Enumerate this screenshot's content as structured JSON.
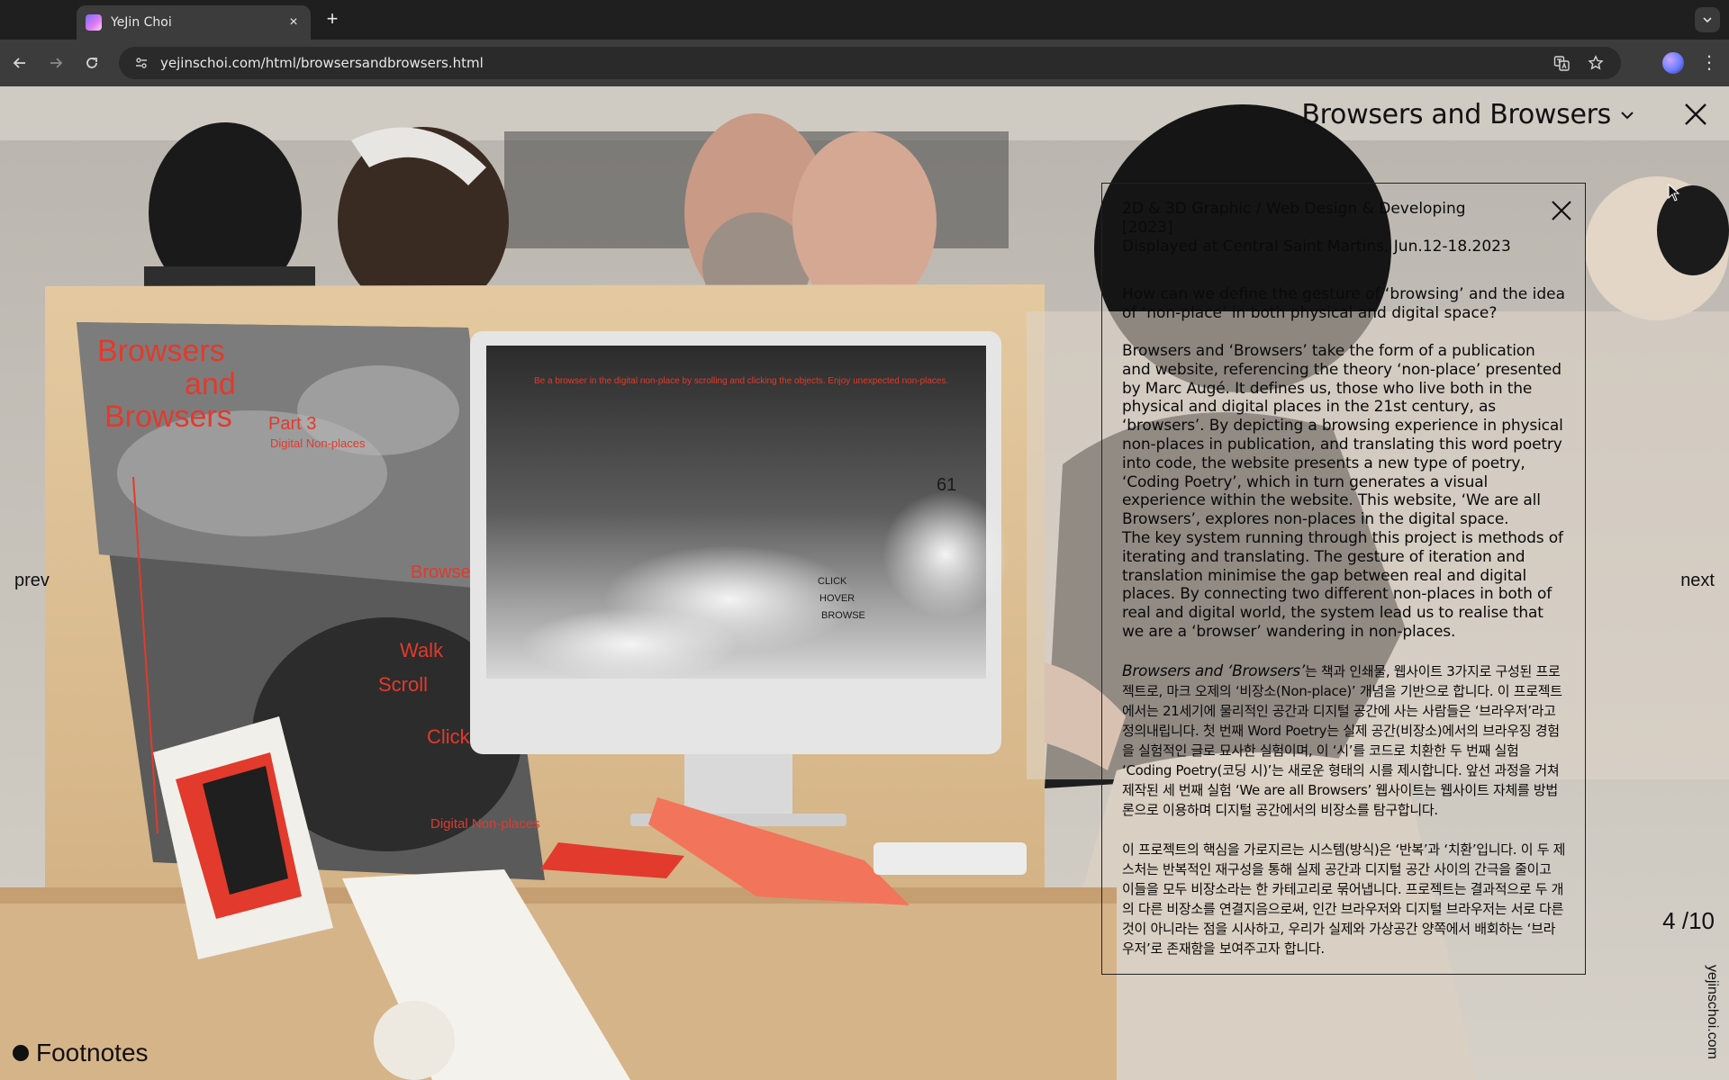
{
  "browser": {
    "tab_title": "YeJin Choi",
    "tab_close": "×",
    "new_tab": "+",
    "url": "yejinschoi.com/html/browsersandbrowsers.html"
  },
  "page": {
    "project_title": "Browsers and Browsers",
    "prev": "prev",
    "next": "next",
    "counter": "4 /10",
    "site_vertical": "yejinschoi.com",
    "footnotes": "Footnotes",
    "photo_text": {
      "poster_title_1": "Browsers",
      "poster_title_2": "and",
      "poster_title_3": "Browsers",
      "poster_part": "Part 3",
      "poster_subtitle": "Digital Non-places",
      "poster_browse": "Browse",
      "poster_walk": "Walk",
      "poster_scroll": "Scroll",
      "poster_click": "Click",
      "poster_footer": "Digital Non-places",
      "screen_text": "Be a browser in the digital non-place by scrolling and clicking the objects. Enjoy unexpected non-places.",
      "screen_number": "61",
      "screen_menu_1": "CLICK",
      "screen_menu_2": "HOVER",
      "screen_menu_3": "BROWSE"
    }
  },
  "info": {
    "meta_line_1": "2D & 3D Graphic / Web Design & Developing [2023]",
    "meta_line_2": "Displayed at Central Saint Martins, Jun.12-18.2023",
    "question": "How can we define the gesture of ‘browsing’ and the idea of ‘non-place’ in both physical and digital space?",
    "para_en": "Browsers and ‘Browsers’ take the form of a publication and website, referencing the theory ‘non-place’ presented by Marc Augé. It defines us, those who live both in the physical and digital places in the 21st century, as ‘browsers’. By depicting a browsing experience in physical non-places in publication, and translating this word poetry into code, the website presents a new type of poetry, ‘Coding Poetry’, which in turn generates a visual experience within the website. This website, ‘We are all Browsers’, explores non-places in the digital space.\nThe key system running through this project is methods of iterating and translating. The gesture of iteration and translation minimise the gap between real and digital places. By connecting two different non-places in both of real and digital world, the system lead us to realise that we are a ‘browser’ wandering in non-places.",
    "para_ko_italic": "Browsers and ‘Browsers’",
    "para_ko_rest": "는 책과 인쇄물, 웹사이트 3가지로 구성된 프로젝트로, 마크 오제의 ‘비장소(Non-place)’ 개념을 기반으로 합니다. 이 프로젝트에서는 21세기에 물리적인 공간과 디지털 공간에 사는 사람들은 ‘브라우저’라고 정의내립니다. 첫 번째 Word Poetry는 실제 공간(비장소)에서의 브라우징 경험을 실험적인 글로 묘사한 실험이며, 이 ‘시’를 코드로 치환한 두 번째 실험 ‘Coding Poetry(코딩 시)’는 새로운 형태의 시를 제시합니다. 앞선 과정을 거쳐 제작된 세 번째 실험 ‘We are all Browsers’ 웹사이트는 웹사이트 자체를 방법론으로 이용하며 디지털 공간에서의 비장소를 탐구합니다.",
    "para_ko2": "이 프로젝트의 핵심을 가로지르는 시스템(방식)은 ‘반복’과 ‘치환’입니다. 이 두 제스처는 반복적인 재구성을 통해 실제 공간과 디지털 공간 사이의 간극을 줄이고 이들을 모두 비장소라는 한 카테고리로 묶어냅니다. 프로젝트는 결과적으로 두 개의 다른 비장소를 연결지음으로써, 인간 브라우저와 디지털 브라우저는 서로 다른 것이 아니라는 점을 시사하고, 우리가 실제와 가상공간 양쪽에서 배회하는 ‘브라우저’로 존재함을 보여주고자 합니다."
  },
  "colors": {
    "chrome_bg": "#1f1f1f",
    "toolbar_bg": "#3c3c3c",
    "poster_red": "#e23a2c",
    "wood": "#d8b98a"
  },
  "icons": [
    "back-arrow-icon",
    "forward-arrow-icon",
    "reload-icon",
    "site-info-icon",
    "translate-icon",
    "star-icon",
    "kebab-menu-icon",
    "close-icon",
    "chevron-down-icon"
  ]
}
